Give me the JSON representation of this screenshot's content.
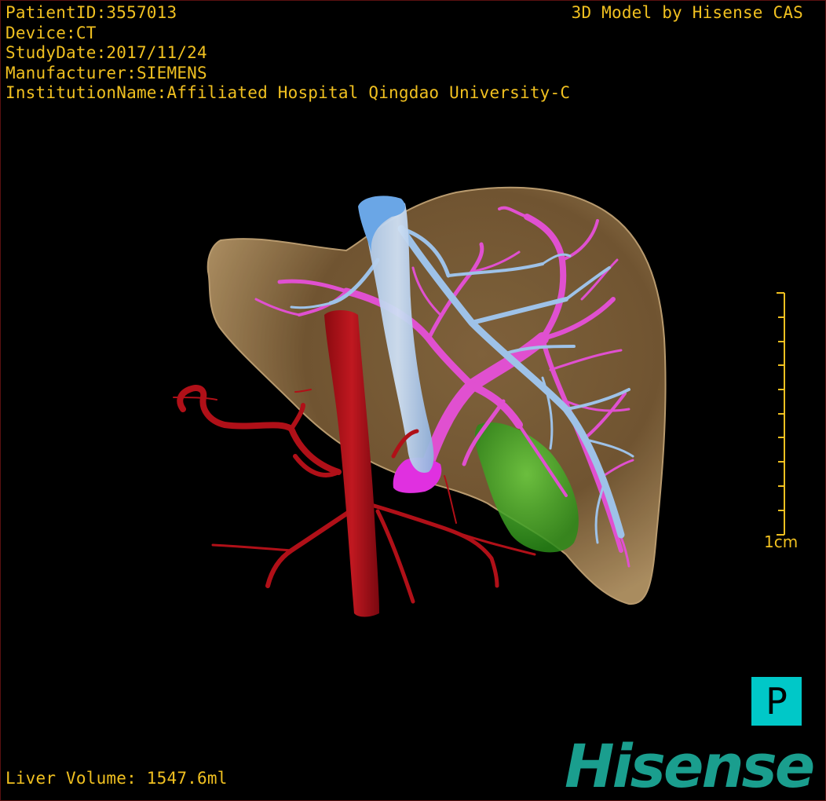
{
  "patient_info": {
    "patient_id": "PatientID:3557013",
    "device": "Device:CT",
    "study_date": "StudyDate:2017/11/24",
    "manufacturer": "Manufacturer:SIEMENS",
    "institution": "InstitutionName:Affiliated Hospital Qingdao University-C"
  },
  "brand_label": "3D Model by Hisense CAS",
  "volume_label": "Liver Volume: 1547.6ml",
  "scale": {
    "label": "1cm",
    "color": "#f0c020"
  },
  "orientation": {
    "label": "P",
    "color": "#00c8c8"
  },
  "logo_text": "Hisense",
  "colors": {
    "text": "#f0c020",
    "liver": "#b08a5a",
    "portal_vein": "#e050d0",
    "hepatic_vein": "#9ec2e8",
    "artery": "#b01018",
    "gallbladder": "#40b020",
    "logo": "#1a9e8e"
  }
}
